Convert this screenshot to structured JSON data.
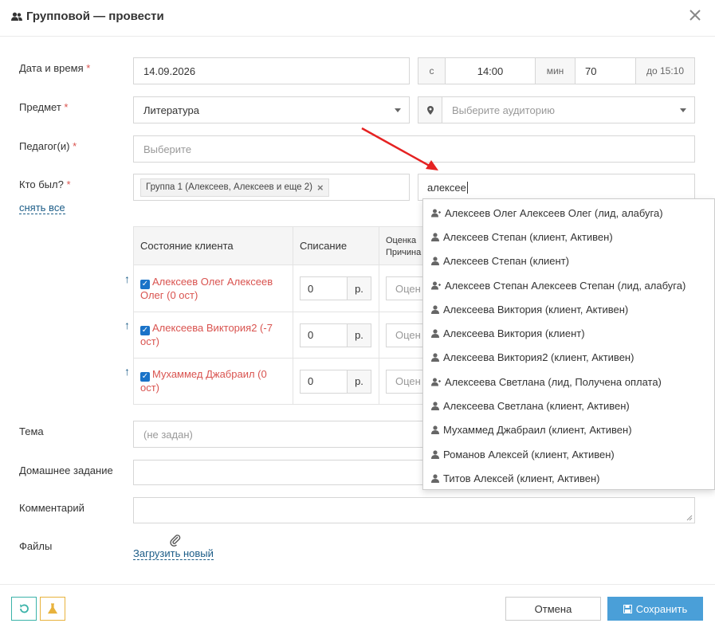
{
  "header": {
    "title": "Групповой — провести"
  },
  "form": {
    "date_label": "Дата и время",
    "date_value": "14.09.2026",
    "from_label": "с",
    "time_value": "14:00",
    "min_label": "мин",
    "duration_value": "70",
    "until_label": "до 15:10",
    "subject_label": "Предмет",
    "subject_value": "Литература",
    "room_placeholder": "Выберите аудиторию",
    "teacher_label": "Педагог(и)",
    "teacher_placeholder": "Выберите",
    "who_label": "Кто был?",
    "group_tag": "Группа 1 (Алексеев, Алексеев и еще 2)",
    "unselect_all": "снять все",
    "search_value": "алексее",
    "topic_label": "Тема",
    "topic_placeholder": "(не задан)",
    "homework_label": "Домашнее задание",
    "comment_label": "Комментарий",
    "files_label": "Файлы",
    "upload_link": "Загрузить новый",
    "required_mark": "*"
  },
  "table": {
    "headers": {
      "state": "Состояние клиента",
      "charge": "Списание",
      "grade_line1": "Оценка",
      "grade_line2": "Причина"
    },
    "rows": [
      {
        "name": "Алексеев Олег Алексеев Олег (0 ост)",
        "amount": "0",
        "currency": "р.",
        "grade_placeholder": "Оцен"
      },
      {
        "name": "Алексеева Виктория2 (-7 ост)",
        "amount": "0",
        "currency": "р.",
        "grade_placeholder": "Оцен"
      },
      {
        "name": "Мухаммед Джабраил (0 ост)",
        "amount": "0",
        "currency": "р.",
        "grade_placeholder": "Оцен"
      }
    ]
  },
  "dropdown": {
    "items": [
      {
        "label": "Алексеев Олег Алексеев Олег (лид, алабуга)",
        "icon": "lead-icon"
      },
      {
        "label": "Алексеев Степан (клиент, Активен)",
        "icon": "user-icon"
      },
      {
        "label": "Алексеев Степан (клиент)",
        "icon": "user-icon"
      },
      {
        "label": "Алексеев Степан Алексеев Степан (лид, алабуга)",
        "icon": "lead-icon"
      },
      {
        "label": "Алексеева Виктория (клиент, Активен)",
        "icon": "user-icon"
      },
      {
        "label": "Алексеева Виктория (клиент)",
        "icon": "user-icon"
      },
      {
        "label": "Алексеева Виктория2 (клиент, Активен)",
        "icon": "user-icon"
      },
      {
        "label": "Алексеева Светлана (лид, Получена оплата)",
        "icon": "lead-icon"
      },
      {
        "label": "Алексеева Светлана (клиент, Активен)",
        "icon": "user-icon"
      },
      {
        "label": "Мухаммед Джабраил (клиент, Активен)",
        "icon": "user-icon"
      },
      {
        "label": "Романов Алексей (клиент, Активен)",
        "icon": "user-icon"
      },
      {
        "label": "Титов Алексей (клиент, Активен)",
        "icon": "user-icon"
      }
    ]
  },
  "footer": {
    "cancel_label": "Отмена",
    "save_label": "Сохранить"
  },
  "colors": {
    "accent": "#4a9fd8",
    "required": "#d9534f",
    "link": "#1b5c87",
    "history_btn": "#3bb3a9",
    "clear_btn": "#e8b23c",
    "arrow": "#e52222"
  }
}
